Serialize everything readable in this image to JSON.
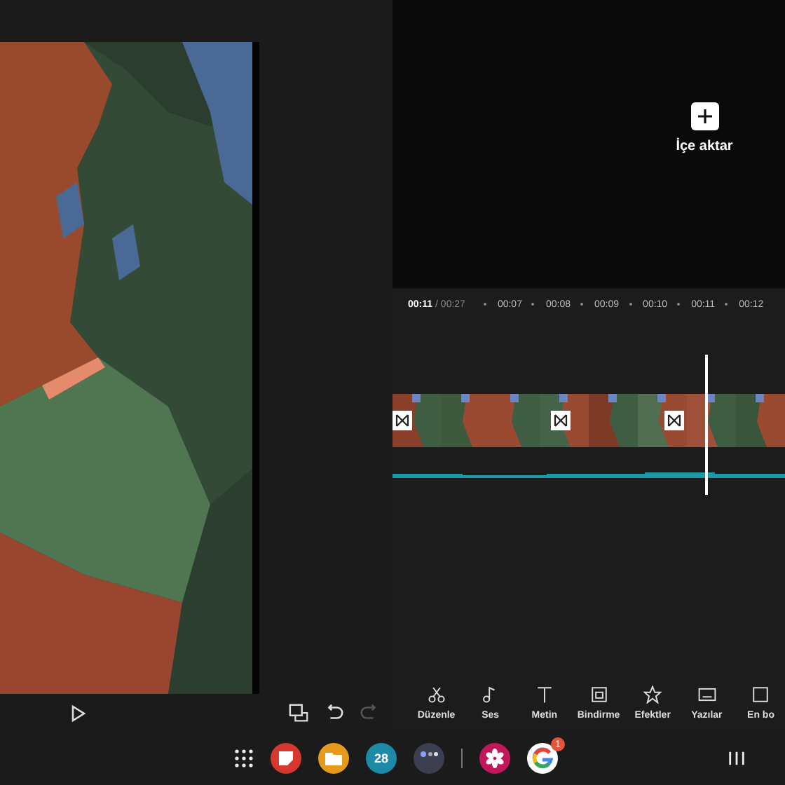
{
  "edit_controls": [
    {
      "kind": "screen-off",
      "disabled": false
    },
    {
      "kind": "undo",
      "disabled": false
    },
    {
      "kind": "redo",
      "disabled": true
    }
  ],
  "import": {
    "label": "İçe aktar"
  },
  "timeline": {
    "current": "00:11",
    "total": "/ 00:27",
    "ticks": [
      "00:07",
      "00:08",
      "00:09",
      "00:10",
      "00:11",
      "00:12"
    ]
  },
  "tools": [
    {
      "kind": "scissors",
      "label": "Düzenle"
    },
    {
      "kind": "note",
      "label": "Ses"
    },
    {
      "kind": "text",
      "label": "Metin"
    },
    {
      "kind": "overlay",
      "label": "Bindirme"
    },
    {
      "kind": "star",
      "label": "Efektler"
    },
    {
      "kind": "caption",
      "label": "Yazılar"
    },
    {
      "kind": "frame",
      "label": "En bo"
    }
  ],
  "taskbar": {
    "apps": [
      {
        "kind": "notes"
      },
      {
        "kind": "files"
      },
      {
        "kind": "calendar",
        "day": "28"
      },
      {
        "kind": "folder"
      },
      {
        "kind": "flower"
      },
      {
        "kind": "google",
        "badge": "1"
      }
    ]
  }
}
